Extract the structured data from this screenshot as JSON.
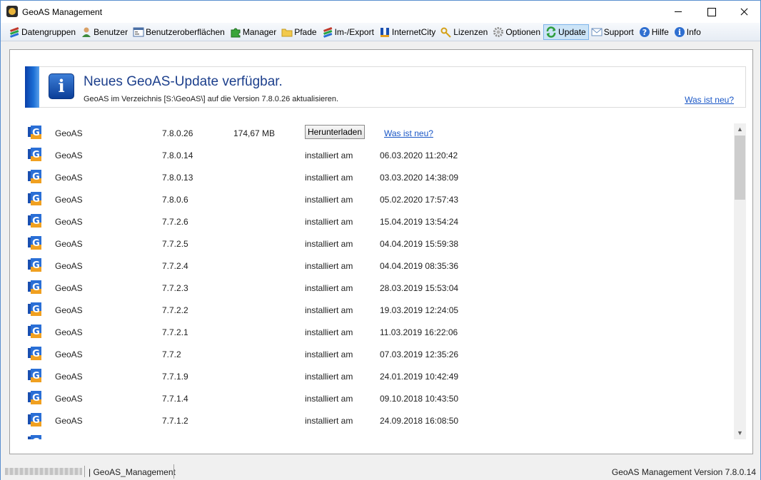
{
  "window": {
    "title": "GeoAS Management"
  },
  "toolbar": {
    "items": [
      {
        "label": "Datengruppen",
        "icon": "data-groups-icon"
      },
      {
        "label": "Benutzer",
        "icon": "user-icon"
      },
      {
        "label": "Benutzeroberflächen",
        "icon": "ui-form-icon"
      },
      {
        "label": "Manager",
        "icon": "puzzle-icon"
      },
      {
        "label": "Pfade",
        "icon": "folder-icon"
      },
      {
        "label": "Im-/Export",
        "icon": "import-export-icon"
      },
      {
        "label": "InternetCity",
        "icon": "internetcity-icon"
      },
      {
        "label": "Lizenzen",
        "icon": "key-icon"
      },
      {
        "label": "Optionen",
        "icon": "gear-icon"
      },
      {
        "label": "Update",
        "icon": "update-icon",
        "active": true
      },
      {
        "label": "Support",
        "icon": "envelope-icon"
      },
      {
        "label": "Hilfe",
        "icon": "help-icon"
      },
      {
        "label": "Info",
        "icon": "info-icon"
      }
    ]
  },
  "banner": {
    "title": "Neues GeoAS-Update verfügbar.",
    "subtitle": "GeoAS im Verzeichnis [S:\\GeoAS\\] auf die Version 7.8.0.26 aktualisieren.",
    "link": "Was ist neu?"
  },
  "versions": [
    {
      "name": "GeoAS",
      "version": "7.8.0.26",
      "size": "174,67 MB",
      "button": "Herunterladen",
      "link": "Was ist neu?"
    },
    {
      "name": "GeoAS",
      "version": "7.8.0.14",
      "status": "installiert am",
      "date": "06.03.2020 11:20:42"
    },
    {
      "name": "GeoAS",
      "version": "7.8.0.13",
      "status": "installiert am",
      "date": "03.03.2020 14:38:09"
    },
    {
      "name": "GeoAS",
      "version": "7.8.0.6",
      "status": "installiert am",
      "date": "05.02.2020 17:57:43"
    },
    {
      "name": "GeoAS",
      "version": "7.7.2.6",
      "status": "installiert am",
      "date": "15.04.2019 13:54:24"
    },
    {
      "name": "GeoAS",
      "version": "7.7.2.5",
      "status": "installiert am",
      "date": "04.04.2019 15:59:38"
    },
    {
      "name": "GeoAS",
      "version": "7.7.2.4",
      "status": "installiert am",
      "date": "04.04.2019 08:35:36"
    },
    {
      "name": "GeoAS",
      "version": "7.7.2.3",
      "status": "installiert am",
      "date": "28.03.2019 15:53:04"
    },
    {
      "name": "GeoAS",
      "version": "7.7.2.2",
      "status": "installiert am",
      "date": "19.03.2019 12:24:05"
    },
    {
      "name": "GeoAS",
      "version": "7.7.2.1",
      "status": "installiert am",
      "date": "11.03.2019 16:22:06"
    },
    {
      "name": "GeoAS",
      "version": "7.7.2",
      "status": "installiert am",
      "date": "07.03.2019 12:35:26"
    },
    {
      "name": "GeoAS",
      "version": "7.7.1.9",
      "status": "installiert am",
      "date": "24.01.2019 10:42:49"
    },
    {
      "name": "GeoAS",
      "version": "7.7.1.4",
      "status": "installiert am",
      "date": "09.10.2018 10:43:50"
    },
    {
      "name": "GeoAS",
      "version": "7.7.1.2",
      "status": "installiert am",
      "date": "24.09.2018 16:08:50"
    }
  ],
  "statusbar": {
    "app": "GeoAS_Management",
    "version_text": "GeoAS Management Version 7.8.0.14"
  },
  "colors": {
    "accent": "#1c3f8c",
    "link": "#1a57c6",
    "active_tab_bg": "#cce4f7",
    "banner_stripe": "#0a3fa8"
  }
}
